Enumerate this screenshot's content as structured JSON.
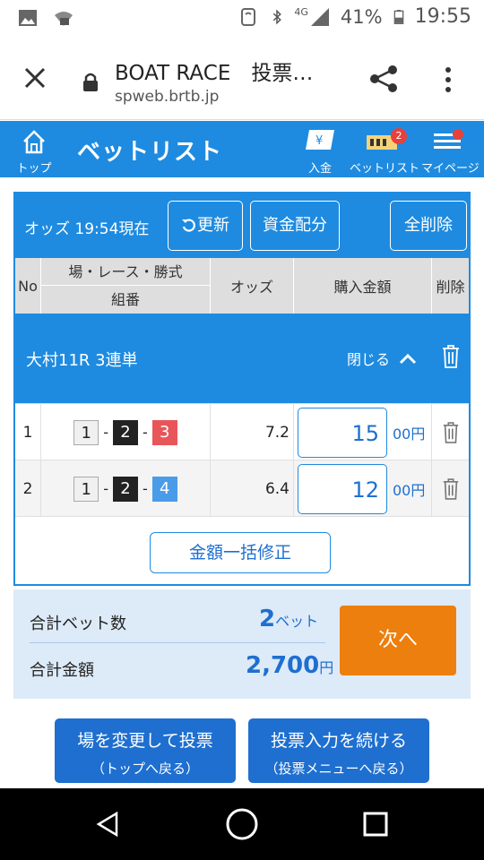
{
  "status": {
    "network": "4G",
    "battery": "41%",
    "time": "19:55"
  },
  "browser": {
    "title": "BOAT RACE　投票…",
    "url": "spweb.brtb.jp"
  },
  "header": {
    "home_label": "トップ",
    "title": "ベットリスト",
    "deposit_label": "入金",
    "betlist_label": "ベットリスト",
    "betlist_badge": "2",
    "mypage_label": "マイページ"
  },
  "odds_bar": {
    "odds_time": "オッズ 19:54現在",
    "refresh_label": "更新",
    "allocate_label": "資金配分",
    "delete_all_label": "全削除"
  },
  "table": {
    "headers": {
      "no": "No",
      "place": "場・レース・勝式",
      "combo": "組番",
      "odds": "オッズ",
      "amount": "購入金額",
      "delete": "削除"
    },
    "group": {
      "title": "大村11R 3連単",
      "close_label": "閉じる"
    },
    "rows": [
      {
        "no": "1",
        "n1": "1",
        "n2": "2",
        "n3": "3",
        "odds": "7.2",
        "amount": "15",
        "unit": "00円"
      },
      {
        "no": "2",
        "n1": "1",
        "n2": "2",
        "n3": "4",
        "odds": "6.4",
        "amount": "12",
        "unit": "00円"
      }
    ],
    "bulk_label": "金額一括修正"
  },
  "summary": {
    "bets_label": "合計ベット数",
    "bets_value": "2",
    "bets_unit": "ベット",
    "total_label": "合計金額",
    "total_value": "2,700",
    "total_unit": "円",
    "next_label": "次へ"
  },
  "footer": {
    "change_label": "場を変更して投票",
    "change_sub": "（トップへ戻る）",
    "continue_label": "投票入力を続ける",
    "continue_sub": "（投票メニューへ戻る）"
  },
  "colors": {
    "primary": "#1e8be0",
    "accent": "#ec7f0e",
    "summary_bg": "#ddeaf8"
  },
  "icons": [
    "gallery-icon",
    "wifi-off-icon",
    "nfc-icon",
    "bluetooth-icon",
    "signal-icon",
    "battery-icon",
    "close-icon",
    "lock-icon",
    "share-icon",
    "more-icon",
    "home-icon",
    "yen-card-icon",
    "ticket-icon",
    "menu-icon",
    "refresh-icon",
    "chevron-up-icon",
    "trash-icon",
    "back-icon",
    "home-circle-icon",
    "recents-icon"
  ]
}
